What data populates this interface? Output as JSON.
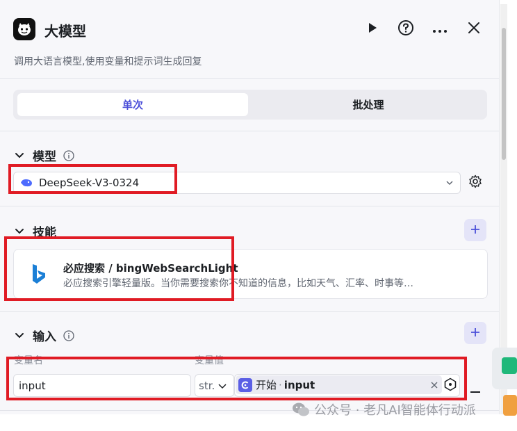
{
  "header": {
    "title": "大模型",
    "description": "调用大语言模型,使用变量和提示词生成回复"
  },
  "tabs": [
    {
      "label": "单次",
      "active": true
    },
    {
      "label": "批处理",
      "active": false
    }
  ],
  "model_section": {
    "title": "模型",
    "selected_model": "DeepSeek-V3-0324"
  },
  "skills_section": {
    "title": "技能",
    "skills": [
      {
        "name": "必应搜索 / bingWebSearchLight",
        "description": "必应搜索引擎轻量版。当你需要搜索你不知道的信息，比如天气、汇率、时事等…"
      }
    ]
  },
  "input_section": {
    "title": "输入",
    "col_name_label": "变量名",
    "col_value_label": "变量值",
    "rows": [
      {
        "name": "input",
        "type": "str.",
        "ref_node": "开始",
        "ref_separator": "·",
        "ref_var": "input"
      }
    ]
  },
  "watermark": "公众号 · 老凡AI智能体行动派",
  "colors": {
    "accent": "#4b4fd9",
    "highlight_box": "#e01b24",
    "background": "#f7f7fa"
  },
  "icons": [
    "app-logo-icon",
    "play-icon",
    "help-icon",
    "more-icon",
    "close-icon",
    "chevron-down-icon",
    "info-icon",
    "deepseek-whale-icon",
    "settings-gear-icon",
    "plus-icon",
    "bing-icon",
    "clear-icon",
    "variable-picker-icon",
    "minus-icon",
    "wechat-icon"
  ]
}
